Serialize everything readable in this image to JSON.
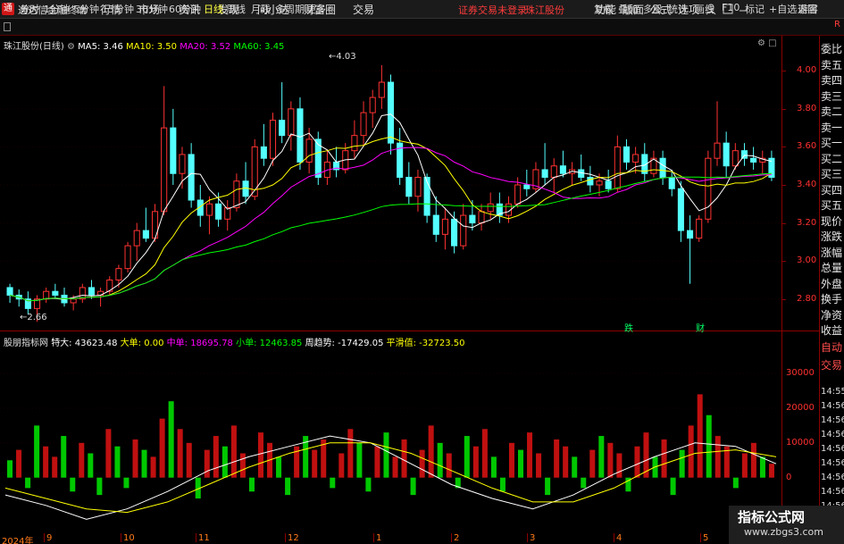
{
  "app": {
    "logo": "通",
    "title": "通达信金融终端",
    "menu": [
      "行情",
      "市场",
      "资讯",
      "发现",
      "问小达",
      "财富圈",
      "交易"
    ],
    "login_status": "证券交易未登录",
    "broker": "珠江股份",
    "menu_right": [
      "功能",
      "版面",
      "公式",
      "选项"
    ],
    "window_controls": [
      "游客"
    ]
  },
  "toolbar": {
    "periods": [
      "分时",
      "1分钟",
      "5分钟",
      "15分钟",
      "30分钟",
      "60分钟",
      "日线",
      "周线",
      "月线",
      "多周期",
      "更多"
    ],
    "active": "日线",
    "right": [
      "复权",
      "叠加",
      "多股",
      "统计",
      "画线",
      "F10",
      "标记",
      "+自选",
      "返回"
    ]
  },
  "main_legend": {
    "stock": "珠江股份(日线)",
    "ma5": "MA5: 3.46",
    "ma10": "MA10: 3.50",
    "ma20": "MA20: 3.52",
    "ma60": "MA60: 3.45"
  },
  "indicator_legend": {
    "name": "股朋指标网",
    "xl": "特大: 43623.48",
    "l": "大单: 0.00",
    "m": "中单: 18695.78",
    "s": "小单: 12463.85",
    "trend": "周趋势: -17429.05",
    "smooth": "平滑值: -32723.50"
  },
  "annotations": {
    "high": "4.03",
    "low": "2.66",
    "tag1": "跌",
    "tag2": "财"
  },
  "right_panel": [
    "委比",
    "卖五",
    "卖四",
    "卖三",
    "卖二",
    "卖一",
    "买一",
    "买二",
    "买三",
    "买四",
    "买五",
    "现价",
    "涨跌",
    "涨幅",
    "总量",
    "外盘",
    "换手",
    "净资",
    "收益",
    "自动",
    "交易",
    "14:55",
    "14:56",
    "14:56",
    "14:56",
    "14:56",
    "14:56",
    "14:56",
    "14:56",
    "14:56"
  ],
  "date_axis": {
    "labels": [
      "2024年",
      "9",
      "10",
      "11",
      "12",
      "1",
      "2",
      "3",
      "4",
      "5"
    ]
  },
  "watermark": {
    "title": "指标公式网",
    "url": "www.zbgs3.com"
  },
  "colors": {
    "up": "#ff3232",
    "down": "#54ffff",
    "ma5": "#ffffff",
    "ma10": "#ffff00",
    "ma20": "#ff00ff",
    "ma60": "#00ff00"
  },
  "chart_data": [
    {
      "type": "candlestick",
      "title": "珠江股份(日线)",
      "y_ticks": [
        "4.00",
        "3.80",
        "3.60",
        "3.40",
        "3.20",
        "3.00",
        "2.80"
      ],
      "ylim": [
        2.7,
        4.1
      ],
      "ohlc": [
        [
          2.86,
          2.88,
          2.78,
          2.82
        ],
        [
          2.82,
          2.85,
          2.76,
          2.8
        ],
        [
          2.8,
          2.84,
          2.72,
          2.75
        ],
        [
          2.75,
          2.82,
          2.68,
          2.8
        ],
        [
          2.8,
          2.86,
          2.78,
          2.84
        ],
        [
          2.84,
          2.88,
          2.8,
          2.82
        ],
        [
          2.82,
          2.86,
          2.76,
          2.78
        ],
        [
          2.78,
          2.82,
          2.74,
          2.8
        ],
        [
          2.8,
          2.88,
          2.78,
          2.86
        ],
        [
          2.86,
          2.9,
          2.8,
          2.82
        ],
        [
          2.82,
          2.86,
          2.76,
          2.84
        ],
        [
          2.84,
          2.92,
          2.82,
          2.9
        ],
        [
          2.9,
          2.98,
          2.86,
          2.96
        ],
        [
          2.96,
          3.1,
          2.94,
          3.08
        ],
        [
          3.08,
          3.2,
          3.0,
          3.16
        ],
        [
          3.16,
          3.28,
          3.1,
          3.12
        ],
        [
          3.12,
          3.3,
          3.1,
          3.26
        ],
        [
          3.26,
          3.92,
          3.24,
          3.7
        ],
        [
          3.7,
          3.8,
          3.4,
          3.46
        ],
        [
          3.46,
          3.6,
          3.38,
          3.56
        ],
        [
          3.56,
          3.62,
          3.28,
          3.32
        ],
        [
          3.32,
          3.4,
          3.18,
          3.24
        ],
        [
          3.24,
          3.34,
          3.14,
          3.3
        ],
        [
          3.3,
          3.36,
          3.18,
          3.22
        ],
        [
          3.22,
          3.32,
          3.16,
          3.28
        ],
        [
          3.28,
          3.46,
          3.26,
          3.42
        ],
        [
          3.42,
          3.52,
          3.3,
          3.34
        ],
        [
          3.34,
          3.64,
          3.32,
          3.6
        ],
        [
          3.6,
          3.72,
          3.5,
          3.54
        ],
        [
          3.54,
          3.78,
          3.5,
          3.74
        ],
        [
          3.74,
          3.94,
          3.62,
          3.66
        ],
        [
          3.66,
          3.84,
          3.58,
          3.8
        ],
        [
          3.8,
          3.86,
          3.48,
          3.52
        ],
        [
          3.52,
          3.7,
          3.46,
          3.64
        ],
        [
          3.64,
          3.68,
          3.4,
          3.44
        ],
        [
          3.44,
          3.58,
          3.4,
          3.52
        ],
        [
          3.52,
          3.6,
          3.44,
          3.48
        ],
        [
          3.48,
          3.62,
          3.46,
          3.58
        ],
        [
          3.58,
          3.74,
          3.54,
          3.66
        ],
        [
          3.66,
          3.84,
          3.6,
          3.78
        ],
        [
          3.78,
          3.9,
          3.7,
          3.86
        ],
        [
          3.86,
          4.03,
          3.8,
          3.94
        ],
        [
          3.94,
          3.98,
          3.56,
          3.62
        ],
        [
          3.62,
          3.7,
          3.4,
          3.44
        ],
        [
          3.44,
          3.52,
          3.3,
          3.34
        ],
        [
          3.34,
          3.48,
          3.26,
          3.44
        ],
        [
          3.44,
          3.46,
          3.2,
          3.24
        ],
        [
          3.24,
          3.34,
          3.1,
          3.14
        ],
        [
          3.14,
          3.28,
          3.06,
          3.22
        ],
        [
          3.22,
          3.26,
          3.04,
          3.08
        ],
        [
          3.08,
          3.3,
          3.06,
          3.24
        ],
        [
          3.24,
          3.32,
          3.16,
          3.2
        ],
        [
          3.2,
          3.3,
          3.16,
          3.26
        ],
        [
          3.26,
          3.36,
          3.22,
          3.3
        ],
        [
          3.3,
          3.36,
          3.2,
          3.24
        ],
        [
          3.24,
          3.34,
          3.2,
          3.3
        ],
        [
          3.3,
          3.44,
          3.28,
          3.4
        ],
        [
          3.4,
          3.48,
          3.34,
          3.38
        ],
        [
          3.38,
          3.52,
          3.36,
          3.48
        ],
        [
          3.48,
          3.62,
          3.4,
          3.44
        ],
        [
          3.44,
          3.54,
          3.36,
          3.5
        ],
        [
          3.5,
          3.58,
          3.44,
          3.46
        ],
        [
          3.46,
          3.52,
          3.4,
          3.48
        ],
        [
          3.48,
          3.56,
          3.42,
          3.44
        ],
        [
          3.44,
          3.5,
          3.36,
          3.4
        ],
        [
          3.4,
          3.46,
          3.34,
          3.42
        ],
        [
          3.42,
          3.48,
          3.36,
          3.38
        ],
        [
          3.38,
          3.66,
          3.36,
          3.6
        ],
        [
          3.6,
          3.64,
          3.48,
          3.52
        ],
        [
          3.52,
          3.6,
          3.46,
          3.56
        ],
        [
          3.56,
          3.62,
          3.42,
          3.46
        ],
        [
          3.46,
          3.58,
          3.44,
          3.54
        ],
        [
          3.54,
          3.58,
          3.4,
          3.44
        ],
        [
          3.44,
          3.48,
          3.34,
          3.38
        ],
        [
          3.38,
          3.42,
          3.1,
          3.16
        ],
        [
          3.16,
          3.24,
          2.88,
          3.12
        ],
        [
          3.12,
          3.24,
          3.1,
          3.22
        ],
        [
          3.22,
          3.58,
          3.2,
          3.54
        ],
        [
          3.54,
          3.84,
          3.5,
          3.62
        ],
        [
          3.62,
          3.68,
          3.44,
          3.5
        ],
        [
          3.5,
          3.62,
          3.48,
          3.58
        ],
        [
          3.58,
          3.62,
          3.5,
          3.54
        ],
        [
          3.54,
          3.6,
          3.48,
          3.52
        ],
        [
          3.52,
          3.58,
          3.46,
          3.54
        ],
        [
          3.54,
          3.58,
          3.42,
          3.44
        ]
      ]
    },
    {
      "type": "bar",
      "title": "股朋指标网",
      "y_ticks": [
        "30000",
        "20000",
        "10000",
        "0"
      ],
      "ylim": [
        -15000,
        38000
      ],
      "values": [
        5000,
        8000,
        -3000,
        15000,
        9000,
        6000,
        12000,
        -4000,
        10000,
        7000,
        -5000,
        14000,
        9000,
        -3000,
        11000,
        8000,
        6000,
        17000,
        22000,
        14000,
        10000,
        -6000,
        8000,
        12000,
        9000,
        15000,
        7000,
        -4000,
        13000,
        10000,
        6000,
        -5000,
        9000,
        12000,
        8000,
        11000,
        -3000,
        7000,
        14000,
        10000,
        -4000,
        9000,
        13000,
        6000,
        11000,
        -5000,
        8000,
        15000,
        10000,
        7000,
        -3000,
        12000,
        9000,
        14000,
        6000,
        -4000,
        10000,
        8000,
        13000,
        7000,
        -5000,
        11000,
        9000,
        6000,
        -3000,
        8000,
        12000,
        10000,
        7000,
        -4000,
        9000,
        13000,
        6000,
        11000,
        -5000,
        8000,
        15000,
        24000,
        18000,
        12000,
        9000,
        -3000,
        7000,
        10000,
        6000,
        4000
      ],
      "series": [
        {
          "name": "周趋势",
          "values": [
            -5000,
            -8000,
            -12000,
            -9000,
            -4000,
            2000,
            6000,
            9000,
            12000,
            10000,
            4000,
            -2000,
            -6000,
            -9000,
            -5000,
            1000,
            6000,
            10000,
            9000,
            4000
          ]
        },
        {
          "name": "平滑值",
          "values": [
            -3000,
            -6000,
            -9000,
            -10000,
            -7000,
            -2000,
            3000,
            7000,
            10000,
            10000,
            7000,
            2000,
            -3000,
            -7000,
            -7000,
            -3000,
            3000,
            7000,
            8000,
            6000
          ]
        }
      ]
    }
  ]
}
